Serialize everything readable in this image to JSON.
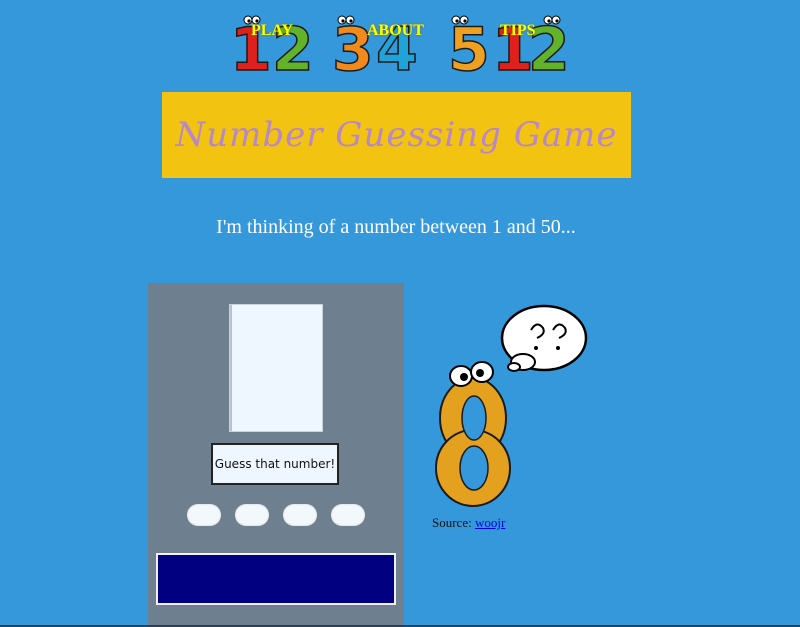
{
  "nav": {
    "play": "PLAY",
    "about": "ABOUT",
    "tips": "TIPS"
  },
  "header": {
    "title": "Number Guessing Game"
  },
  "game": {
    "prompt": "I'm thinking of a number between 1 and 50...",
    "guess_button": "Guess that number!",
    "result_text": ""
  },
  "attribution": {
    "label": "Source:",
    "link_text": "woojr"
  },
  "colors": {
    "background": "#3598db",
    "title_box": "#f2c310",
    "title_text": "#b787c9",
    "nav_text": "#ffff00",
    "panel": "#6e7f90",
    "result_box": "#000080"
  }
}
